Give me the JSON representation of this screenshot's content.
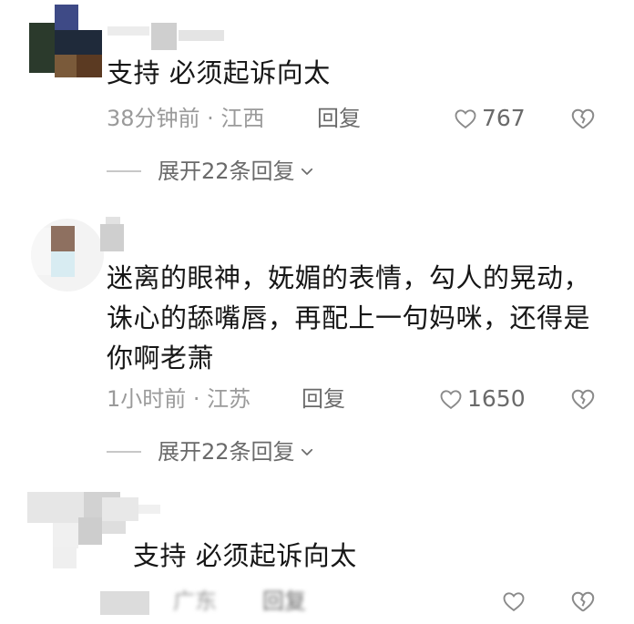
{
  "comments": [
    {
      "content": "支持 必须起诉向太",
      "time": "38分钟前 · 江西",
      "reply_label": "回复",
      "likes": "767",
      "expand_label": "展开22条回复"
    },
    {
      "content": "迷离的眼神，妩媚的表情，勾人的晃动，诛心的舔嘴唇，再配上一句妈咪，还得是你啊老萧",
      "time": "1小时前 · 江苏",
      "reply_label": "回复",
      "likes": "1650",
      "expand_label": "展开22条回复"
    },
    {
      "content": "支持 必须起诉向太",
      "time": "广东",
      "reply_label": "回复"
    }
  ],
  "colors": {
    "text": "#161616",
    "meta": "#9a9a9a",
    "action": "#6a6a6a",
    "icon": "#8a8a8a"
  },
  "icons": {
    "like": "heart-outline-icon",
    "dislike": "broken-heart-icon",
    "expand": "chevron-down-icon"
  }
}
